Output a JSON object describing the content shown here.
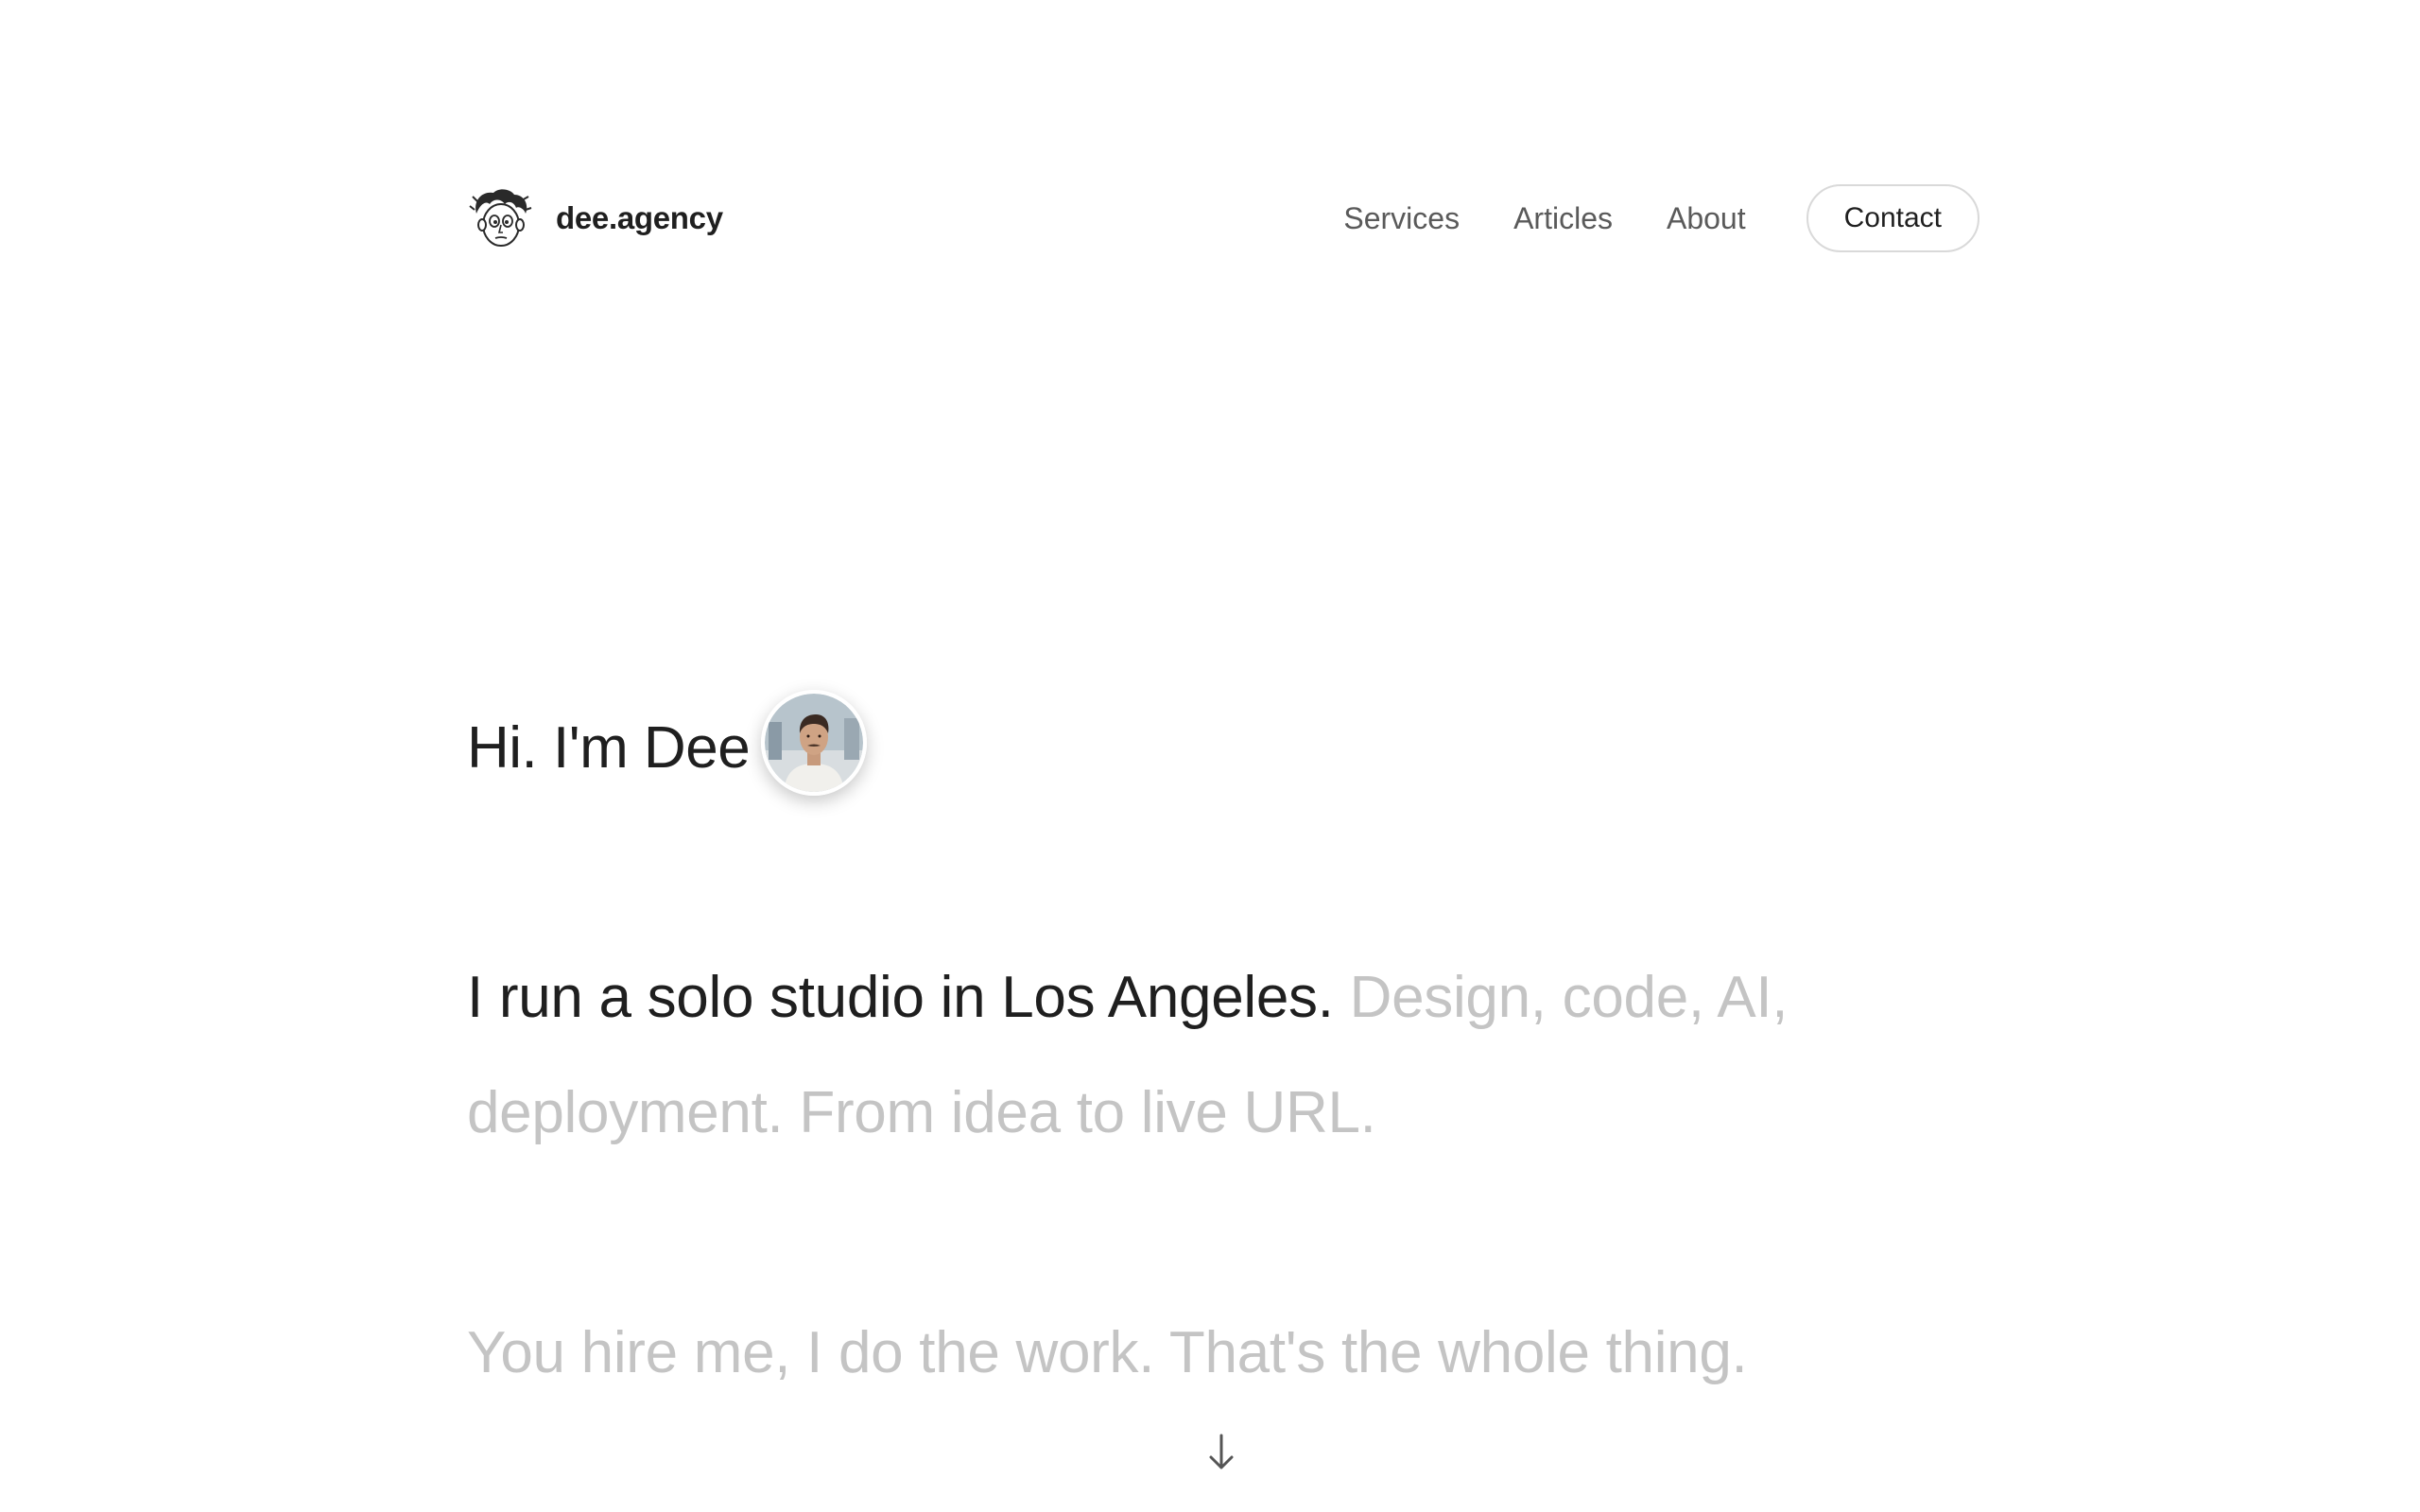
{
  "header": {
    "brand_name": "dee.agency",
    "logo_icon": "caricature-face-icon",
    "nav": [
      {
        "label": "Services"
      },
      {
        "label": "Articles"
      },
      {
        "label": "About"
      }
    ],
    "contact_label": "Contact"
  },
  "hero": {
    "greeting": "Hi. I'm Dee",
    "intro_strong": "I run a solo studio in Los Angeles.",
    "intro_muted": "Design, code, AI, deployment. From idea to live URL.",
    "tagline": "You hire me, I do the work. That's the whole thing.",
    "scroll_icon": "arrow-down-icon"
  },
  "colors": {
    "text": "#1f1f1f",
    "nav": "#5a5a5a",
    "muted": "#c4c4c4",
    "border": "#d9d9d9",
    "background": "#ffffff"
  }
}
